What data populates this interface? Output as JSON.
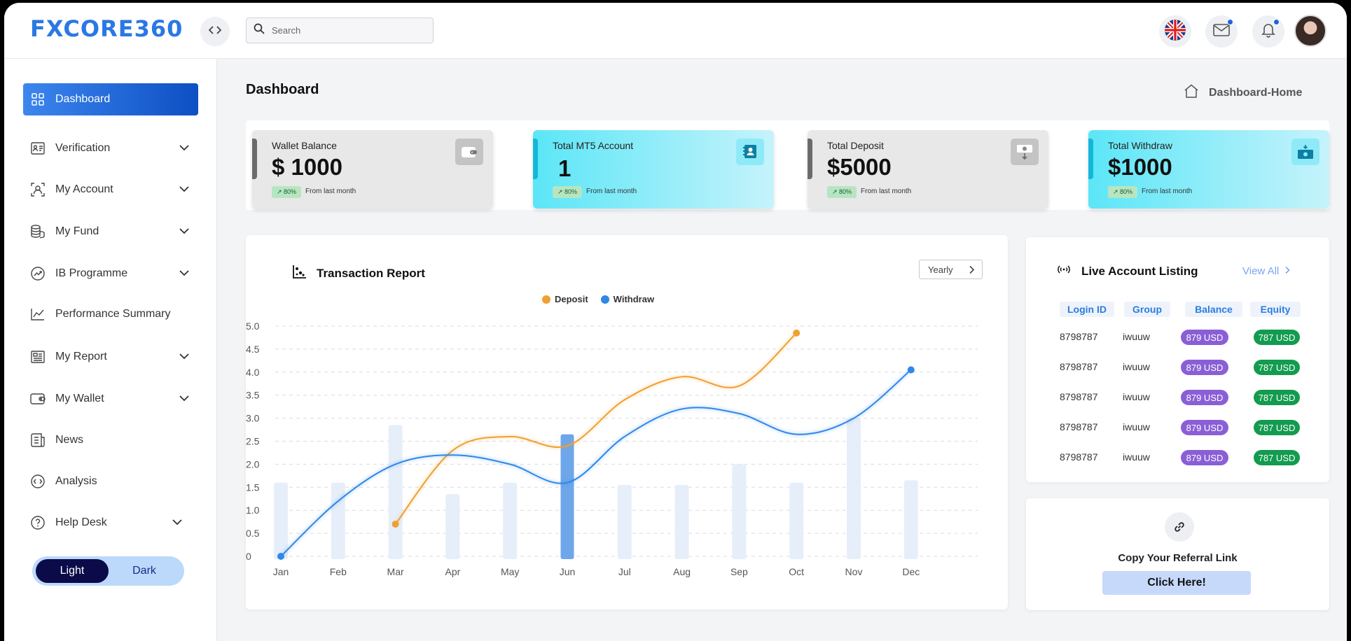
{
  "app": {
    "logo_text": "FXCORE360"
  },
  "topbar": {
    "search_placeholder": "Search",
    "icons": [
      "code-toggle-icon",
      "uk-flag-icon",
      "mail-icon",
      "bell-icon",
      "avatar"
    ],
    "accent": "#2a78e4"
  },
  "sidebar": {
    "items": [
      {
        "label": "Dashboard",
        "icon": "grid-icon",
        "active": true,
        "has_children": false
      },
      {
        "label": "Verification",
        "icon": "id-card-icon",
        "has_children": true
      },
      {
        "label": "My Account",
        "icon": "user-icon",
        "has_children": true
      },
      {
        "label": "My Fund",
        "icon": "coins-icon",
        "has_children": true
      },
      {
        "label": "IB Programme",
        "icon": "trend-icon",
        "has_children": true
      },
      {
        "label": "Performance Summary",
        "icon": "chart-line-icon",
        "has_children": false
      },
      {
        "label": "My Report",
        "icon": "report-icon",
        "has_children": true
      },
      {
        "label": "My Wallet",
        "icon": "wallet-icon",
        "has_children": true
      },
      {
        "label": "News",
        "icon": "news-icon",
        "has_children": false
      },
      {
        "label": "Analysis",
        "icon": "analysis-icon",
        "has_children": false
      },
      {
        "label": "Help Desk",
        "icon": "help-icon",
        "has_children": true
      }
    ],
    "theme": {
      "light": "Light",
      "dark": "Dark",
      "selected": "Light"
    }
  },
  "main": {
    "title": "Dashboard",
    "breadcrumb": "Dashboard-Home",
    "stats": [
      {
        "label": "Wallet Balance",
        "value": "$ 1000",
        "badge": "↗ 80%",
        "sub": "From last month",
        "style": "grey",
        "icon": "wallet-icon"
      },
      {
        "label": "Total MT5 Account",
        "value": "1",
        "badge": "↗ 80%",
        "sub": "From last month",
        "style": "cyan",
        "icon": "account-icon"
      },
      {
        "label": "Total  Deposit",
        "value": "$5000",
        "badge": "↗ 80%",
        "sub": "From last month",
        "style": "grey",
        "icon": "deposit-icon"
      },
      {
        "label": "Total Withdraw",
        "value": "$1000",
        "badge": "↗ 80%",
        "sub": "From last month",
        "style": "cyan",
        "icon": "cash-icon"
      }
    ]
  },
  "report": {
    "title": "Transaction Report",
    "period": "Yearly"
  },
  "chart_data": {
    "type": "line",
    "title": "Transaction Report",
    "categories": [
      "Jan",
      "Feb",
      "Mar",
      "Apr",
      "May",
      "Jun",
      "Jul",
      "Aug",
      "Sep",
      "Oct",
      "Nov",
      "Dec"
    ],
    "ylim": [
      0,
      5
    ],
    "yticks": [
      "0",
      "0.5",
      "1.0",
      "1.5",
      "2.0",
      "2.5",
      "3.0",
      "3.5",
      "4.0",
      "4.5",
      "5.0"
    ],
    "bars": [
      1.6,
      1.6,
      2.85,
      1.35,
      1.6,
      2.65,
      1.55,
      1.55,
      2.0,
      1.6,
      3.0,
      1.65
    ],
    "highlight_bar": "Jun",
    "series": [
      {
        "name": "Deposit",
        "color": "#f0a030",
        "x": [
          "Mar",
          "Apr",
          "May",
          "Jun",
          "Jul",
          "Aug",
          "Sep",
          "Oct"
        ],
        "values": [
          0.7,
          2.3,
          2.6,
          2.4,
          3.4,
          3.9,
          3.7,
          4.85
        ]
      },
      {
        "name": "Withdraw",
        "color": "#2f88e8",
        "x": [
          "Jan",
          "Feb",
          "Mar",
          "Apr",
          "May",
          "Jun",
          "Jul",
          "Aug",
          "Sep",
          "Oct",
          "Nov",
          "Dec"
        ],
        "values": [
          0,
          1.2,
          2.0,
          2.2,
          2.0,
          1.6,
          2.6,
          3.2,
          3.1,
          2.65,
          3.0,
          4.05
        ]
      }
    ],
    "legend_position": "top-center",
    "grid": true
  },
  "live_accounts": {
    "title": "Live Account Listing",
    "view_all": "View All",
    "headers": [
      "Login ID",
      "Group",
      "Balance",
      "Equity"
    ],
    "rows": [
      {
        "login": "8798787",
        "group": "iwuuw",
        "balance": "879 USD",
        "equity": "787 USD"
      },
      {
        "login": "8798787",
        "group": "iwuuw",
        "balance": "879 USD",
        "equity": "787 USD"
      },
      {
        "login": "8798787",
        "group": "iwuuw",
        "balance": "879 USD",
        "equity": "787 USD"
      },
      {
        "login": "8798787",
        "group": "iwuuw",
        "balance": "879 USD",
        "equity": "787 USD"
      },
      {
        "login": "8798787",
        "group": "iwuuw",
        "balance": "879 USD",
        "equity": "787 USD"
      }
    ]
  },
  "referral": {
    "text": "Copy Your Referral Link",
    "button": "Click Here!"
  }
}
